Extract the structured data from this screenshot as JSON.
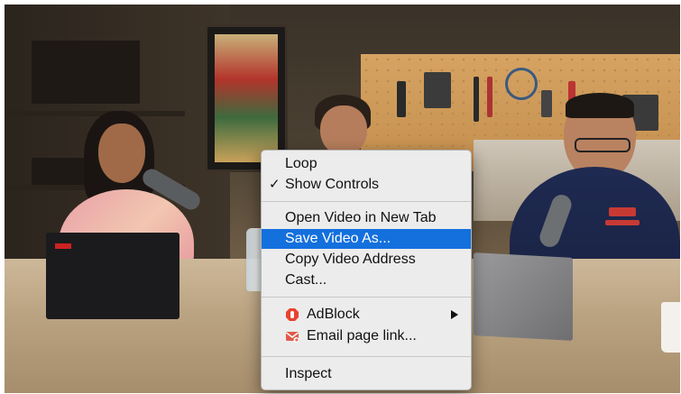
{
  "context_menu": {
    "items": [
      {
        "label": "Loop",
        "checked": false
      },
      {
        "label": "Show Controls",
        "checked": true
      },
      {
        "label": "Open Video in New Tab"
      },
      {
        "label": "Save Video As...",
        "highlighted": true
      },
      {
        "label": "Copy Video Address"
      },
      {
        "label": "Cast..."
      },
      {
        "label": "AdBlock",
        "icon": "adblock-icon",
        "has_submenu": true
      },
      {
        "label": "Email page link...",
        "icon": "email-link-icon"
      },
      {
        "label": "Inspect"
      }
    ],
    "check_glyph": "✓",
    "highlight_color": "#1470dd",
    "adblock_color": "#e8432f",
    "email_icon_color": "#e05a4a"
  }
}
